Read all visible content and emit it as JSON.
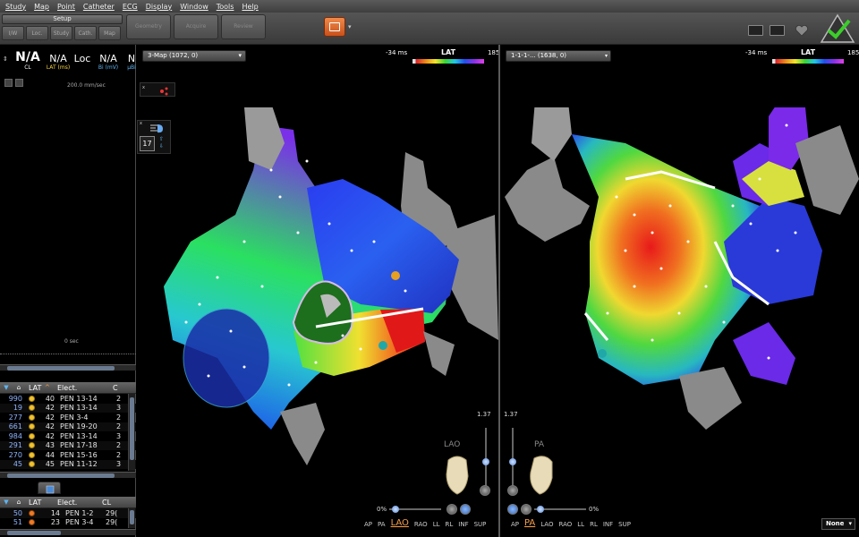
{
  "menu": [
    "Study",
    "Map",
    "Point",
    "Catheter",
    "ECG",
    "Display",
    "Window",
    "Tools",
    "Help"
  ],
  "toolbar": {
    "setup_label": "Setup",
    "setup_buttons": [
      "I/W",
      "Loc.",
      "Study",
      "Cath.",
      "Map"
    ],
    "big_buttons": [
      "Geometry",
      "Acquire",
      "Review"
    ]
  },
  "readouts": {
    "cl": {
      "value": "N/A",
      "label": "CL"
    },
    "lat": {
      "value": "N/A",
      "label": "LAT (ms)"
    },
    "loc": {
      "value": "Loc",
      "label": ""
    },
    "bi": {
      "value": "N/A",
      "label": "Bi (mV)"
    },
    "uni": {
      "value": "N",
      "label": "μBi"
    }
  },
  "sweep_speed": "200.0 mm/sec",
  "time_label": "0 sec",
  "point_table": {
    "headers": [
      "LAT",
      "Elect.",
      "C"
    ],
    "rows": [
      {
        "id": "990",
        "lat": "40",
        "elect": "PEN 13-14",
        "c": "2"
      },
      {
        "id": "19",
        "lat": "42",
        "elect": "PEN 13-14",
        "c": "3"
      },
      {
        "id": "277",
        "lat": "42",
        "elect": "PEN 3-4",
        "c": "2"
      },
      {
        "id": "661",
        "lat": "42",
        "elect": "PEN 19-20",
        "c": "2"
      },
      {
        "id": "984",
        "lat": "42",
        "elect": "PEN 13-14",
        "c": "3"
      },
      {
        "id": "291",
        "lat": "43",
        "elect": "PEN 17-18",
        "c": "2"
      },
      {
        "id": "270",
        "lat": "44",
        "elect": "PEN 15-16",
        "c": "2"
      },
      {
        "id": "45",
        "lat": "45",
        "elect": "PEN 11-12",
        "c": "3"
      }
    ]
  },
  "lesion_table": {
    "headers": [
      "LAT",
      "Elect.",
      "CL"
    ],
    "rows": [
      {
        "id": "50",
        "lat": "14",
        "elect": "PEN 1-2",
        "c": "29("
      },
      {
        "id": "51",
        "lat": "23",
        "elect": "PEN 3-4",
        "c": "29("
      }
    ]
  },
  "left_view": {
    "map_label": "3-Map (1072, 0)",
    "lat_min": "-34 ms",
    "lat_title": "LAT",
    "lat_max": "185 ms",
    "sidebar_count": "17",
    "orientation": "LAO",
    "transparency": "1.37",
    "zoom": "0%",
    "view_buttons": [
      "AP",
      "PA",
      "LAO",
      "RAO",
      "LL",
      "RL",
      "INF",
      "SUP"
    ],
    "active_view": "LAO"
  },
  "right_view": {
    "map_label": "1-1-1-... (1638, 0)",
    "lat_min": "-34 ms",
    "lat_title": "LAT",
    "lat_max": "185 ms",
    "orientation": "PA",
    "transparency": "1.37",
    "zoom": "0%",
    "view_buttons": [
      "AP",
      "PA",
      "LAO",
      "RAO",
      "LL",
      "RL",
      "INF",
      "SUP"
    ],
    "active_view": "PA",
    "display_mode": "None"
  },
  "colors": {
    "accent": "#f79d4a",
    "id_blue": "#8fb4ff",
    "point_yellow": "#f1c232",
    "lesion_orange": "#ee7b27"
  }
}
